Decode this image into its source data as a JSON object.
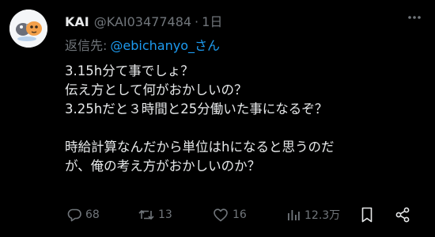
{
  "tweet": {
    "display_name": "KAI",
    "handle": "@KAI03477484",
    "separator": "·",
    "time": "1日",
    "reply_to_label": "返信先:",
    "reply_to_user": "@ebichanyo_さん",
    "body_lines": [
      "3.15h分て事でしょ？",
      "伝え方として何がおかしいの？",
      "3.25hだと３時間と25分働いた事になるぞ？",
      "",
      "時給計算なんだから単位はhになると思うのだ",
      "が、俺の考え方がおかしいのか？"
    ],
    "metrics": {
      "replies": "68",
      "retweets": "13",
      "likes": "16",
      "views": "12.3万"
    }
  },
  "icons": {
    "more": "more-dots-icon",
    "reply": "reply-icon",
    "retweet": "retweet-icon",
    "like": "heart-icon",
    "views": "views-chart-icon",
    "bookmark": "bookmark-icon",
    "share": "share-icon"
  },
  "colors": {
    "background": "#000000",
    "text": "#e7e9ea",
    "muted": "#71767b",
    "link": "#1d9bf0"
  }
}
